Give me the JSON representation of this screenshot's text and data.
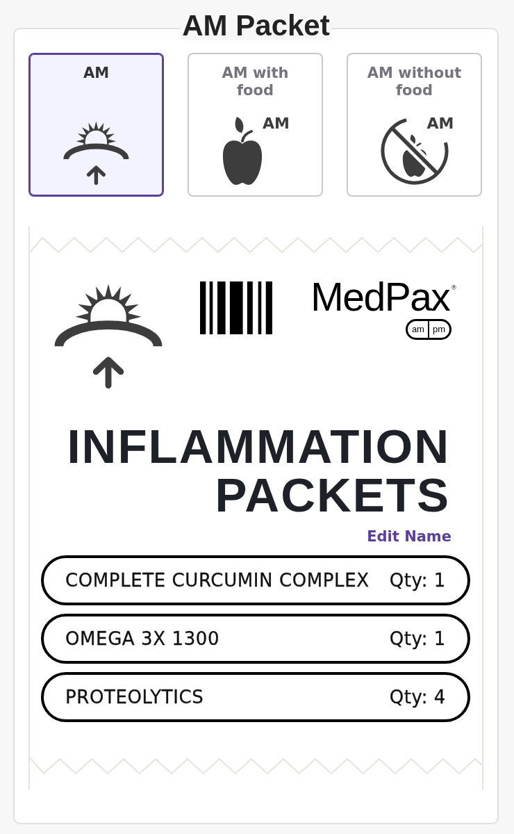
{
  "title": "AM Packet",
  "tabs": [
    {
      "label": "AM",
      "kind": "sunrise",
      "selected": true
    },
    {
      "label": "AM with food",
      "kind": "apple",
      "badge": "AM",
      "selected": false
    },
    {
      "label": "AM without food",
      "kind": "no-apple",
      "badge": "AM",
      "selected": false
    }
  ],
  "packet": {
    "logo": {
      "wordmark": "MedPax$^{®}$",
      "pill": [
        "am",
        "pm"
      ]
    },
    "name": "INFLAMMATION PACKETS",
    "edit_link": "Edit Name",
    "items": [
      {
        "name": "COMPLETE CURCUMIN COMPLEX",
        "qty": "Qty: 1"
      },
      {
        "name": "OMEGA 3X 1300",
        "qty": "Qty: 1"
      },
      {
        "name": "PROTEOLYTICS",
        "qty": "Qty: 4"
      }
    ]
  }
}
